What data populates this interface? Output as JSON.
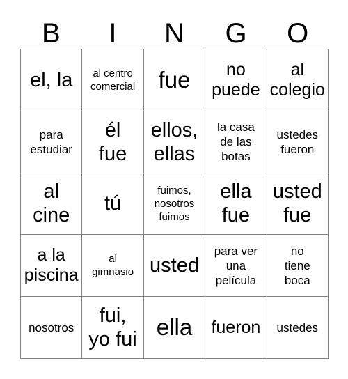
{
  "card": {
    "header_letters": [
      "B",
      "I",
      "N",
      "G",
      "O"
    ],
    "columns": 5,
    "rows": 5,
    "grid_line_color": "#808080",
    "background_color": "#ffffff",
    "text_color": "#000000",
    "cells": [
      [
        {
          "text": "el, la",
          "size": "fs-lg"
        },
        {
          "text": "al centro\ncomercial",
          "size": "fs-xxs"
        },
        {
          "text": "fue",
          "size": "fs-xl"
        },
        {
          "text": "no\npuede",
          "size": "fs-md"
        },
        {
          "text": "al\ncolegio",
          "size": "fs-md"
        }
      ],
      [
        {
          "text": "para\nestudiar",
          "size": "fs-xs"
        },
        {
          "text": "él\nfue",
          "size": "fs-lg"
        },
        {
          "text": "ellos,\nellas",
          "size": "fs-lg"
        },
        {
          "text": "la casa\nde las\nbotas",
          "size": "fs-xs"
        },
        {
          "text": "ustedes\nfueron",
          "size": "fs-xs"
        }
      ],
      [
        {
          "text": "al\ncine",
          "size": "fs-lg"
        },
        {
          "text": "tú",
          "size": "fs-lg"
        },
        {
          "text": "fuimos,\nnosotros\nfuimos",
          "size": "fs-xxs"
        },
        {
          "text": "ella\nfue",
          "size": "fs-lg"
        },
        {
          "text": "usted\nfue",
          "size": "fs-lg"
        }
      ],
      [
        {
          "text": "a la\npiscina",
          "size": "fs-md"
        },
        {
          "text": "al\ngimnasio",
          "size": "fs-xxs"
        },
        {
          "text": "usted",
          "size": "fs-lg"
        },
        {
          "text": "para ver\nuna\npelícula",
          "size": "fs-xs"
        },
        {
          "text": "no\ntiene\nboca",
          "size": "fs-xs"
        }
      ],
      [
        {
          "text": "nosotros",
          "size": "fs-xs"
        },
        {
          "text": "fui,\nyo fui",
          "size": "fs-lg"
        },
        {
          "text": "ella",
          "size": "fs-xl"
        },
        {
          "text": "fueron",
          "size": "fs-md"
        },
        {
          "text": "ustedes",
          "size": "fs-xs"
        }
      ]
    ]
  }
}
